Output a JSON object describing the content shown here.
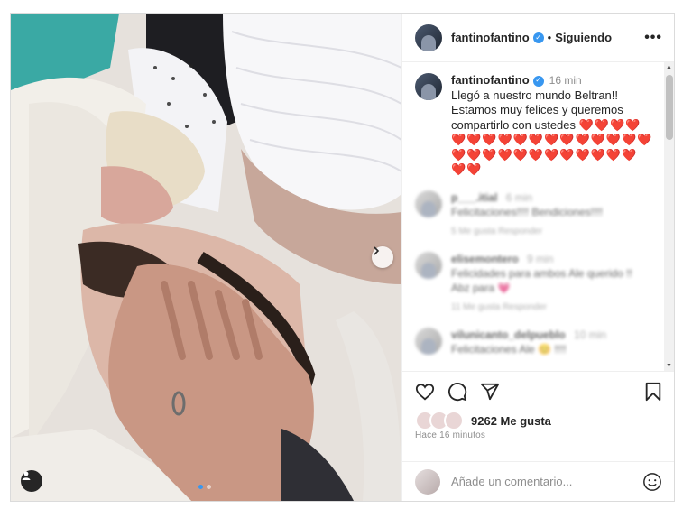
{
  "post": {
    "username": "fantinofantino",
    "follow_label": "Siguiendo",
    "more_label": "•••",
    "caption_time": "16 min",
    "caption_line1": "Llegó a nuestro mundo Beltran!!",
    "caption_line2": "Estamos muy felices y queremos",
    "caption_line3": "compartirlo con ustedes",
    "hearts_line1": "❤️❤️❤️❤️",
    "hearts_line2": "❤️❤️❤️❤️❤️❤️❤️❤️❤️❤️❤️❤️❤️",
    "hearts_line3": "❤️❤️❤️❤️❤️❤️❤️❤️❤️❤️❤️❤️",
    "hearts_line4": "❤️❤️"
  },
  "comments": [
    {
      "user": "p___.itial",
      "time": "6 min",
      "text": "Felicitaciones!!!! Bendiciones!!!!",
      "meta": "5 Me gusta  Responder"
    },
    {
      "user": "elisemontero",
      "time": "9 min",
      "text": "Felicidades para ambos Ale querido !! Abz para 💗",
      "meta": "11 Me gusta  Responder"
    },
    {
      "user": "vilunicanto_delpueblo",
      "time": "10 min",
      "text": "Felicitaciones Ale 😊 !!!!",
      "meta": ""
    }
  ],
  "likes": {
    "count_label": "9262 Me gusta"
  },
  "time_ago": "Hace 16 minutos",
  "comment_box": {
    "placeholder": "Añade un comentario..."
  },
  "icons": [
    "heart-icon",
    "comment-icon",
    "share-icon",
    "bookmark-icon",
    "emoji-icon",
    "chevron-right-icon",
    "user-tag-icon",
    "more-icon",
    "verified-icon"
  ],
  "colors": {
    "accent": "#3897f0",
    "heart": "#d10000",
    "muted": "#8e8e8e"
  }
}
